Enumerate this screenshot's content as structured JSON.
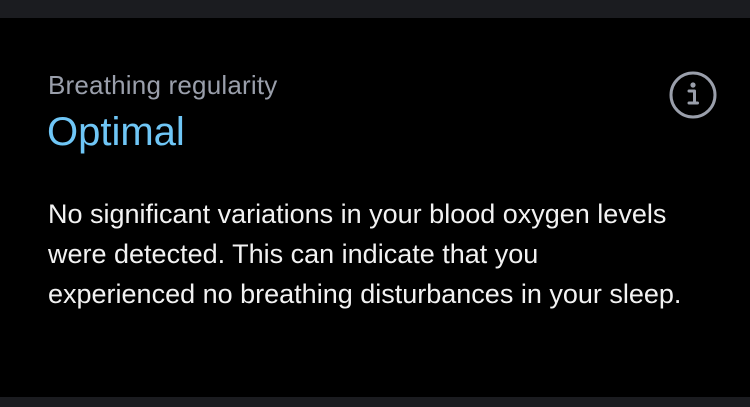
{
  "card": {
    "label": "Breathing regularity",
    "status": "Optimal",
    "description": "No significant variations in your blood oxygen levels were detected. This can indicate that you experienced no breathing disturbances in your sleep.",
    "info_icon": "info-icon",
    "colors": {
      "label": "#9a9fab",
      "status": "#6fc6f6",
      "text": "#f2f2f2",
      "background": "#000000"
    }
  }
}
